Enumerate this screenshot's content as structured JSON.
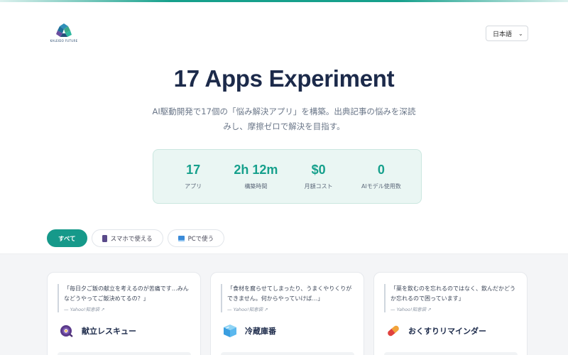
{
  "header": {
    "logo_text": "KALEIDO FUTURE",
    "language": "日本語"
  },
  "hero": {
    "title": "17 Apps Experiment",
    "subtitle": "AI駆動開発で17個の「悩み解決アプリ」を構築。出典記事の悩みを深読みし、摩擦ゼロで解決を目指す。"
  },
  "stats": [
    {
      "value": "17",
      "label": "アプリ"
    },
    {
      "value": "2h 12m",
      "label": "構築時間"
    },
    {
      "value": "$0",
      "label": "月額コスト"
    },
    {
      "value": "0",
      "label": "AIモデル使用数"
    }
  ],
  "filters": [
    {
      "label": "すべて",
      "icon": "none",
      "active": true
    },
    {
      "label": "スマホで使える",
      "icon": "smartphone-icon",
      "active": false
    },
    {
      "label": "PCで使う",
      "icon": "computer-icon",
      "active": false
    }
  ],
  "cards": [
    {
      "quote": "「毎日夕ご飯の献立を考えるのが苦痛です…みんなどうやってご飯決めてるの？」",
      "source": "— Yahoo!知恵袋 ↗",
      "icon": "cooking-pan-icon",
      "name": "献立レスキュー"
    },
    {
      "quote": "「食材を腐らせてしまったり、うまくやりくりができません。何からやっていけば…」",
      "source": "— Yahoo!知恵袋 ↗",
      "icon": "ice-cube-icon",
      "name": "冷蔵庫番"
    },
    {
      "quote": "「薬を飲むのを忘れるのではなく、飲んだかどうか忘れるので困っています」",
      "source": "— Yahoo!知恵袋 ↗",
      "icon": "pill-icon",
      "name": "おくすりリマインダー"
    }
  ],
  "colors": {
    "accent": "#16a08c",
    "title": "#1c2a4a",
    "stats_bg": "#eaf6f3"
  }
}
